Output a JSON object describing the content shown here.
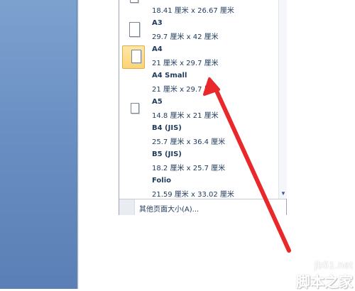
{
  "paper_sizes": [
    {
      "name": "",
      "size": "18.41 厘米 x 26.67 厘米",
      "selected": false
    },
    {
      "name": "A3",
      "size": "29.7 厘米 x 42 厘米",
      "selected": false
    },
    {
      "name": "A4",
      "size": "21 厘米 x 29.7 厘米",
      "selected": true
    },
    {
      "name": "A4 Small",
      "size": "21 厘米 x 29.7 厘米",
      "selected": false
    },
    {
      "name": "A5",
      "size": "14.8 厘米 x 21 厘米",
      "selected": false
    },
    {
      "name": "B4 (JIS)",
      "size": "25.7 厘米 x 36.4 厘米",
      "selected": false
    },
    {
      "name": "B5 (JIS)",
      "size": "18.2 厘米 x 25.7 厘米",
      "selected": false
    },
    {
      "name": "Folio",
      "size": "21.59 厘米 x 33.02 厘米",
      "selected": false
    }
  ],
  "footer": {
    "more_sizes_label": "其他页面大小(A)..."
  },
  "scroll": {
    "arrow_glyph": "▼"
  },
  "watermark": {
    "url": "jb51.net",
    "name": "脚本之家"
  },
  "colors": {
    "annotation_arrow": "#e8282a",
    "selected_highlight": "#fbd475",
    "text": "#1e395b",
    "left_panel": "#6a8fc3"
  }
}
